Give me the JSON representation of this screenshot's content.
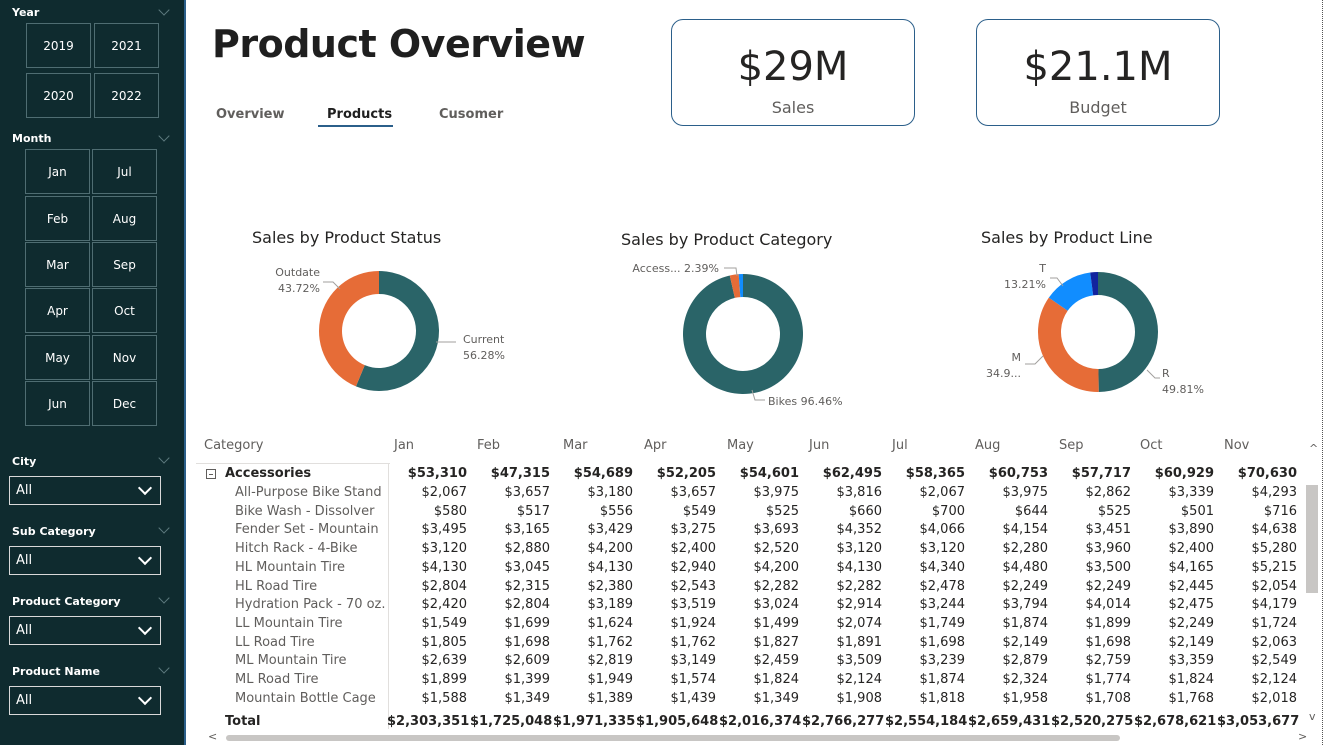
{
  "sidebar": {
    "year_label": "Year",
    "years": [
      "2019",
      "2021",
      "2020",
      "2022"
    ],
    "month_label": "Month",
    "months": [
      "Jan",
      "Jul",
      "Feb",
      "Aug",
      "Mar",
      "Sep",
      "Apr",
      "Oct",
      "May",
      "Nov",
      "Jun",
      "Dec"
    ],
    "filters": [
      {
        "label": "City",
        "value": "All"
      },
      {
        "label": "Sub Category",
        "value": "All"
      },
      {
        "label": "Product Category",
        "value": "All"
      },
      {
        "label": "Product Name",
        "value": "All"
      }
    ]
  },
  "header": {
    "title": "Product Overview",
    "tabs": [
      "Overview",
      "Products",
      "Cusomer"
    ],
    "active_tab": "Products"
  },
  "kpis": [
    {
      "value": "$29M",
      "label": "Sales"
    },
    {
      "value": "$21.1M",
      "label": "Budget"
    }
  ],
  "colors": {
    "teal": "#2a6468",
    "orange": "#e66c37",
    "blue": "#118dff",
    "navy": "#12239e",
    "sidebar": "#0f2b2f",
    "accent": "#2b5f8a"
  },
  "chart_data": [
    {
      "type": "pie",
      "title": "Sales by Product Status",
      "donut": true,
      "slices": [
        {
          "name": "Current",
          "value": 56.28,
          "label": "56.28%"
        },
        {
          "name": "Outdate",
          "value": 43.72,
          "label": "43.72%"
        }
      ]
    },
    {
      "type": "pie",
      "title": "Sales by Product Category",
      "donut": true,
      "slices": [
        {
          "name": "Bikes",
          "value": 96.46,
          "label": "Bikes 96.46%"
        },
        {
          "name": "Access...",
          "value": 2.39,
          "label": "Access... 2.39%"
        },
        {
          "name": "",
          "value": 1.15,
          "label": ""
        }
      ]
    },
    {
      "type": "pie",
      "title": "Sales by Product Line",
      "donut": true,
      "slices": [
        {
          "name": "R",
          "value": 49.81,
          "label": "49.81%"
        },
        {
          "name": "M",
          "value": 34.9,
          "label": "34.9..."
        },
        {
          "name": "T",
          "value": 13.21,
          "label": "13.21%"
        },
        {
          "name": "",
          "value": 2.08,
          "label": ""
        }
      ]
    }
  ],
  "matrix": {
    "category_header": "Category",
    "months": [
      "Jan",
      "Feb",
      "Mar",
      "Apr",
      "May",
      "Jun",
      "Jul",
      "Aug",
      "Sep",
      "Oct",
      "Nov"
    ],
    "group": {
      "name": "Accessories",
      "values": [
        "$53,310",
        "$47,315",
        "$54,689",
        "$52,205",
        "$54,601",
        "$62,495",
        "$58,365",
        "$60,753",
        "$57,717",
        "$60,929",
        "$70,630"
      ]
    },
    "rows": [
      {
        "name": "All-Purpose Bike Stand",
        "values": [
          "$2,067",
          "$3,657",
          "$3,180",
          "$3,657",
          "$3,975",
          "$3,816",
          "$2,067",
          "$3,975",
          "$2,862",
          "$3,339",
          "$4,293"
        ]
      },
      {
        "name": "Bike Wash - Dissolver",
        "values": [
          "$580",
          "$517",
          "$556",
          "$549",
          "$525",
          "$660",
          "$700",
          "$644",
          "$525",
          "$501",
          "$716"
        ]
      },
      {
        "name": "Fender Set - Mountain",
        "values": [
          "$3,495",
          "$3,165",
          "$3,429",
          "$3,275",
          "$3,693",
          "$4,352",
          "$4,066",
          "$4,154",
          "$3,451",
          "$3,890",
          "$4,638"
        ]
      },
      {
        "name": "Hitch Rack - 4-Bike",
        "values": [
          "$3,120",
          "$2,880",
          "$4,200",
          "$2,400",
          "$2,520",
          "$3,120",
          "$3,120",
          "$2,280",
          "$3,960",
          "$2,400",
          "$5,280"
        ]
      },
      {
        "name": "HL Mountain Tire",
        "values": [
          "$4,130",
          "$3,045",
          "$4,130",
          "$2,940",
          "$4,200",
          "$4,130",
          "$4,340",
          "$4,480",
          "$3,500",
          "$4,165",
          "$5,215"
        ]
      },
      {
        "name": "HL Road Tire",
        "values": [
          "$2,804",
          "$2,315",
          "$2,380",
          "$2,543",
          "$2,282",
          "$2,282",
          "$2,478",
          "$2,249",
          "$2,249",
          "$2,445",
          "$2,054"
        ]
      },
      {
        "name": "Hydration Pack - 70 oz.",
        "values": [
          "$2,420",
          "$2,804",
          "$3,189",
          "$3,519",
          "$3,024",
          "$2,914",
          "$3,244",
          "$3,794",
          "$4,014",
          "$2,475",
          "$4,179"
        ]
      },
      {
        "name": "LL Mountain Tire",
        "values": [
          "$1,549",
          "$1,699",
          "$1,624",
          "$1,924",
          "$1,499",
          "$2,074",
          "$1,749",
          "$1,874",
          "$1,899",
          "$2,249",
          "$1,724"
        ]
      },
      {
        "name": "LL Road Tire",
        "values": [
          "$1,805",
          "$1,698",
          "$1,762",
          "$1,762",
          "$1,827",
          "$1,891",
          "$1,698",
          "$2,149",
          "$1,698",
          "$2,149",
          "$2,063"
        ]
      },
      {
        "name": "ML Mountain Tire",
        "values": [
          "$2,639",
          "$2,609",
          "$2,819",
          "$3,149",
          "$2,459",
          "$3,509",
          "$3,239",
          "$2,879",
          "$2,759",
          "$3,359",
          "$2,549"
        ]
      },
      {
        "name": "ML Road Tire",
        "values": [
          "$1,899",
          "$1,399",
          "$1,949",
          "$1,574",
          "$1,824",
          "$2,124",
          "$1,874",
          "$2,324",
          "$1,774",
          "$1,824",
          "$2,124"
        ]
      },
      {
        "name": "Mountain Bottle Cage",
        "values": [
          "$1,588",
          "$1,349",
          "$1,389",
          "$1,439",
          "$1,349",
          "$1,908",
          "$1,818",
          "$1,958",
          "$1,708",
          "$1,768",
          "$2,018"
        ]
      }
    ],
    "total": {
      "name": "Total",
      "values": [
        "$2,303,351",
        "$1,725,048",
        "$1,971,335",
        "$1,905,648",
        "$2,016,374",
        "$2,766,277",
        "$2,554,184",
        "$2,659,431",
        "$2,520,275",
        "$2,678,621",
        "$3,053,677"
      ]
    }
  }
}
